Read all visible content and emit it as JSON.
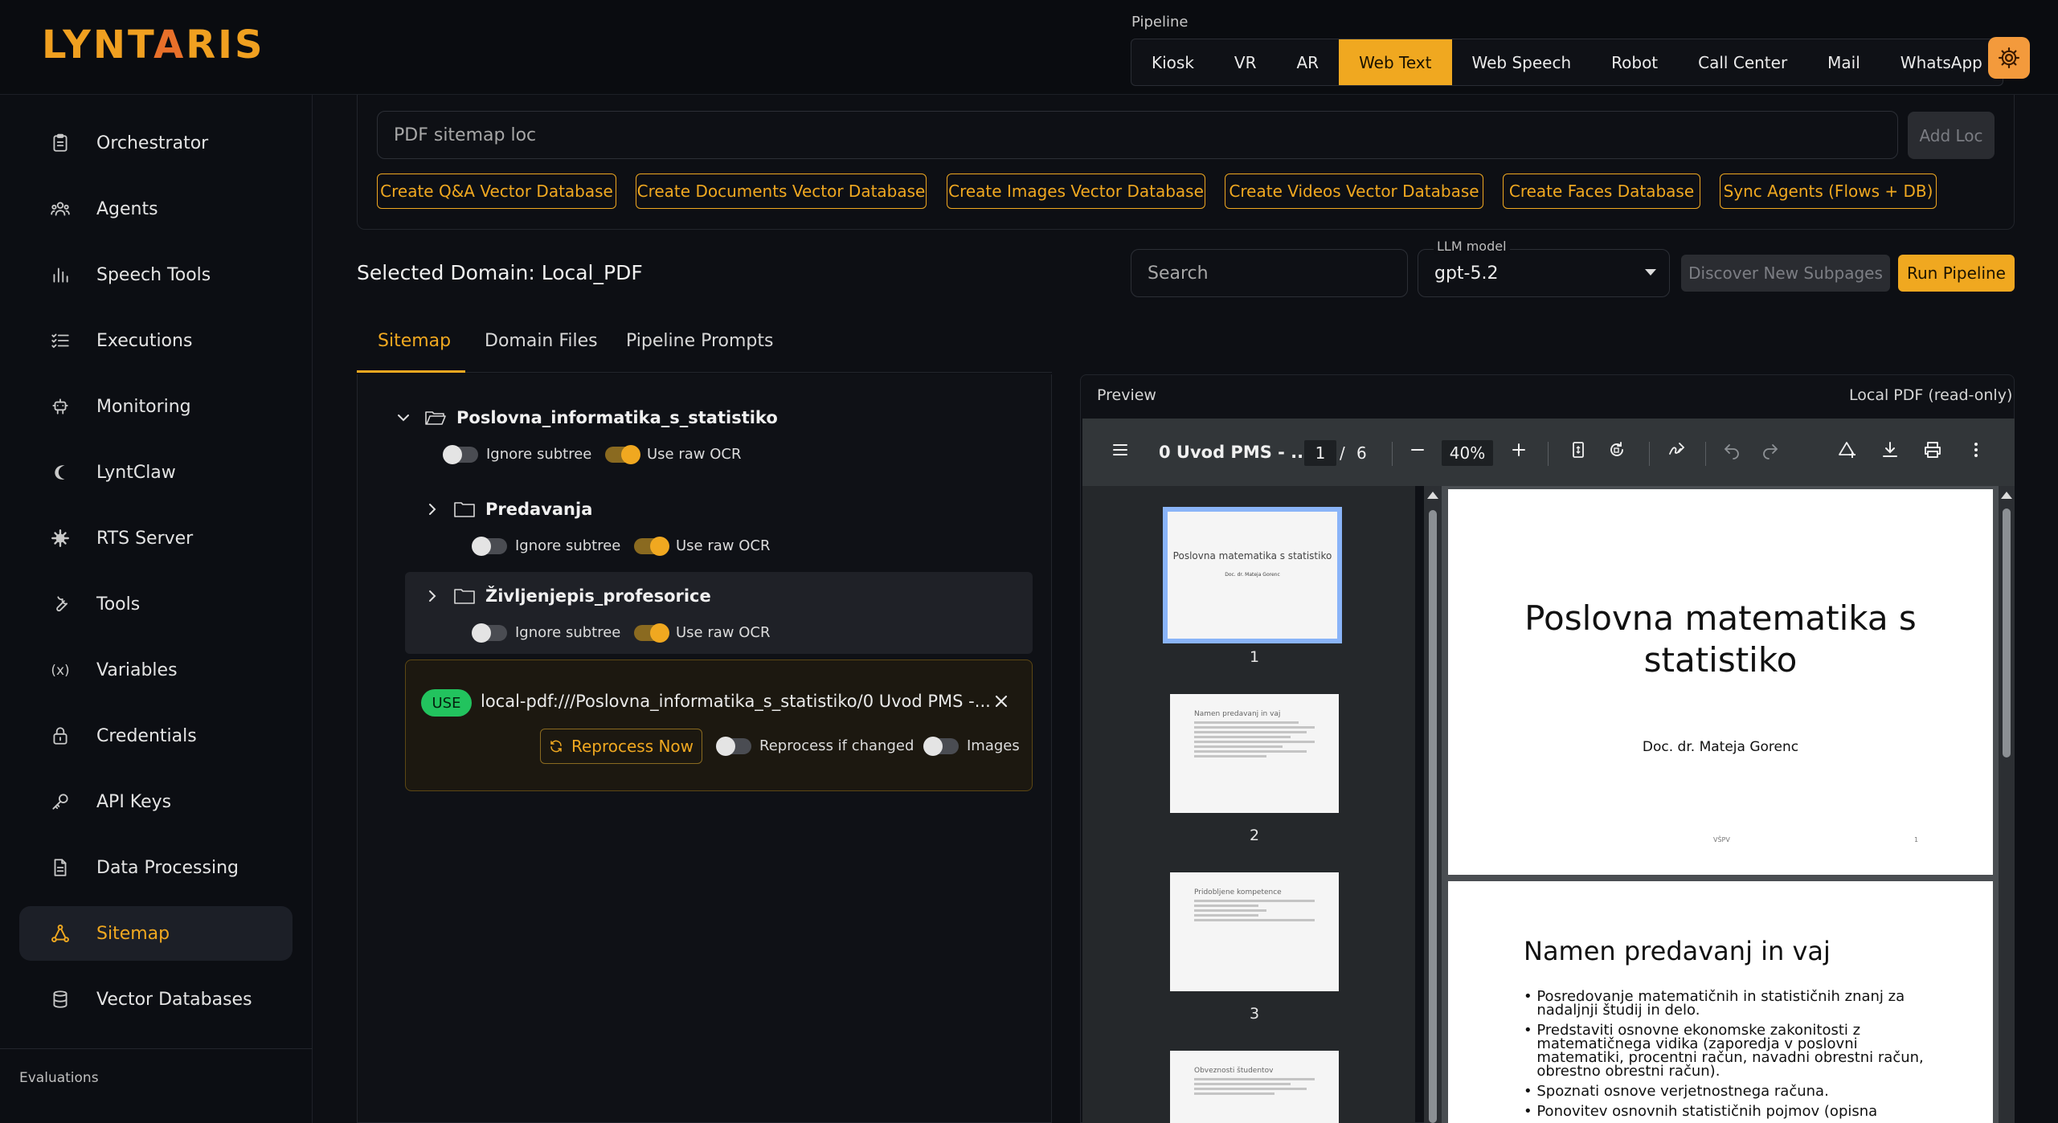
{
  "app": {
    "logo": "LYNTARIS"
  },
  "header": {
    "pipeline_label": "Pipeline",
    "tabs": [
      "Kiosk",
      "VR",
      "AR",
      "Web Text",
      "Web Speech",
      "Robot",
      "Call Center",
      "Mail",
      "WhatsApp"
    ],
    "active_tab": "Web Text",
    "settings_icon": "gear-icon"
  },
  "sidebar": {
    "items": [
      {
        "label": "Orchestrator",
        "icon": "clipboard-icon"
      },
      {
        "label": "Agents",
        "icon": "users-icon"
      },
      {
        "label": "Speech Tools",
        "icon": "bar-chart-icon"
      },
      {
        "label": "Executions",
        "icon": "list-check-icon"
      },
      {
        "label": "Monitoring",
        "icon": "robot-icon"
      },
      {
        "label": "LyntClaw",
        "icon": "claw-icon"
      },
      {
        "label": "RTS Server",
        "icon": "server-icon"
      },
      {
        "label": "Tools",
        "icon": "wrench-icon"
      },
      {
        "label": "Variables",
        "icon": "variable-icon"
      },
      {
        "label": "Credentials",
        "icon": "lock-icon"
      },
      {
        "label": "API Keys",
        "icon": "key-icon"
      },
      {
        "label": "Data Processing",
        "icon": "document-icon"
      },
      {
        "label": "Sitemap",
        "icon": "sitemap-icon"
      },
      {
        "label": "Vector Databases",
        "icon": "database-icon"
      }
    ],
    "active_item": "Sitemap",
    "section_label": "Evaluations"
  },
  "top_card": {
    "loc_placeholder": "PDF sitemap loc",
    "add_loc": "Add Loc",
    "buttons": [
      "Create Q&A Vector Database",
      "Create Documents Vector Database",
      "Create Images Vector Database",
      "Create Videos Vector Database",
      "Create Faces Database",
      "Sync Agents (Flows + DB)"
    ]
  },
  "domain": {
    "selected": "Selected Domain: Local_PDF",
    "search_placeholder": "Search",
    "llm_label": "LLM model",
    "llm_value": "gpt-5.2",
    "discover": "Discover New Subpages",
    "run": "Run Pipeline"
  },
  "main_tabs": [
    "Sitemap",
    "Domain Files",
    "Pipeline Prompts"
  ],
  "tree": {
    "nodes": [
      {
        "name": "Poslovna_informatika_s_statistiko",
        "ignore_subtree": false,
        "use_raw_ocr": true,
        "expanded": true
      },
      {
        "name": "Predavanja",
        "ignore_subtree": false,
        "use_raw_ocr": true,
        "expanded": false
      },
      {
        "name": "Življenjepis_profesorice",
        "ignore_subtree": false,
        "use_raw_ocr": true,
        "expanded": false
      }
    ],
    "ignore_label": "Ignore subtree",
    "ocr_label": "Use raw OCR",
    "use_card": {
      "badge": "USE",
      "path": "local-pdf:///Poslovna_informatika_s_statistiko/0 Uvod PMS -...",
      "reprocess": "Reprocess Now",
      "reprocess_if_changed": "Reprocess if changed",
      "images": "Images",
      "reprocess_if_changed_on": false,
      "images_on": false
    }
  },
  "preview": {
    "title": "Preview",
    "mode": "Local PDF (read-only)",
    "pdf_name": "0 Uvod PMS - ...",
    "page": "1",
    "sep": "/",
    "total": "6",
    "zoom": "40%",
    "thumbs": [
      {
        "num": "1",
        "title": "Poslovna matematika s statistiko",
        "author": "Doc. dr. Mateja Gorenc"
      },
      {
        "num": "2",
        "title": "Namen predavanj in vaj"
      },
      {
        "num": "3",
        "title": "Pridobljene kompetence"
      },
      {
        "num": "4",
        "title": "Obveznosti študentov"
      }
    ],
    "page1": {
      "title_1": "Poslovna matematika s",
      "title_2": "statistiko",
      "author": "Doc. dr. Mateja Gorenc",
      "footer_left": "VŠPV",
      "footer_right": "1"
    },
    "page2": {
      "title": "Namen predavanj in vaj",
      "bullets": [
        "Posredovanje matematičnih in statističnih znanj za nadaljnji študij in delo.",
        "Predstaviti osnovne ekonomske zakonitosti z matematičnega vidika (zaporedja v poslovni matematiki, procentni račun, navadni obrestni račun, obrestno obrestni račun).",
        "Spoznati osnove verjetnostnega računa.",
        "Ponovitev osnovnih statističnih pojmov (opisna"
      ]
    }
  },
  "colors": {
    "accent": "#f0a820",
    "use_badge": "#22c35e",
    "gear": "#f39a3c"
  }
}
